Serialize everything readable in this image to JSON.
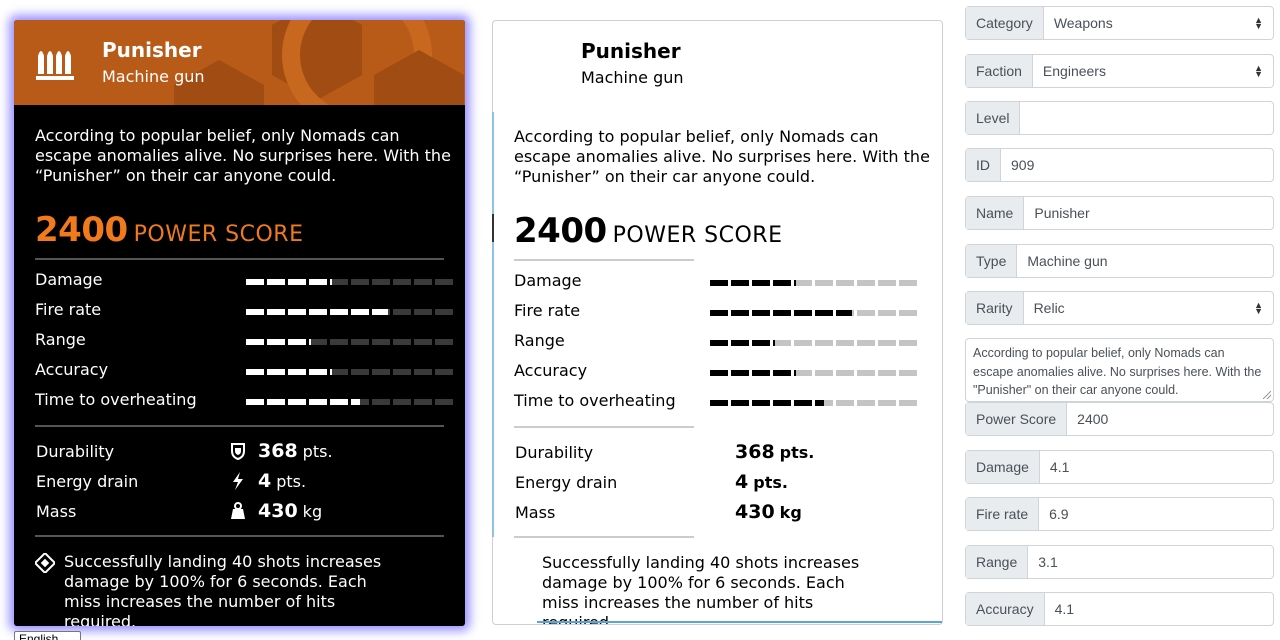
{
  "item": {
    "name": "Punisher",
    "type": "Machine gun",
    "description": "According to popular belief, only Nomads can escape anomalies alive. No surprises here. With the “Punisher” on their car anyone could.",
    "power_score": "2400",
    "power_score_label": "POWER SCORE",
    "stats": [
      {
        "label": "Damage",
        "value": 4.1
      },
      {
        "label": "Fire rate",
        "value": 6.9
      },
      {
        "label": "Range",
        "value": 3.1
      },
      {
        "label": "Accuracy",
        "value": 4.1
      },
      {
        "label": "Time to overheating",
        "value": 5.5
      }
    ],
    "info": [
      {
        "label": "Durability",
        "value": "368",
        "unit": "pts.",
        "icon": "shield-icon"
      },
      {
        "label": "Energy drain",
        "value": "4",
        "unit": "pts.",
        "icon": "lightning-icon"
      },
      {
        "label": "Mass",
        "value": "430",
        "unit": "kg",
        "icon": "weight-icon"
      }
    ],
    "perk": "Successfully landing 40 shots increases damage by 100% for 6 seconds. Each miss increases the number of hits required.",
    "perk_icon": "diamond-perk-icon",
    "header_icon": "ammo-bullets-icon",
    "bar_segments": 10
  },
  "colors": {
    "accent": "#f07a1c",
    "header_bg": "#b85a18",
    "glow": "#7f73ff",
    "bar_on_dark": "#ffffff",
    "bar_off_dark": "#3a3a3a",
    "bar_on_light": "#000000",
    "bar_off_light": "#c4c4c4"
  },
  "form": {
    "category": {
      "label": "Category",
      "value": "Weapons"
    },
    "faction": {
      "label": "Faction",
      "value": "Engineers"
    },
    "level": {
      "label": "Level",
      "value": ""
    },
    "id": {
      "label": "ID",
      "value": "909"
    },
    "name": {
      "label": "Name",
      "value": "Punisher"
    },
    "type": {
      "label": "Type",
      "value": "Machine gun"
    },
    "rarity": {
      "label": "Rarity",
      "value": "Relic"
    },
    "description": "According to popular belief, only Nomads can escape anomalies alive. No surprises here. With the \"Punisher\" on their car anyone could.",
    "power_score": {
      "label": "Power Score",
      "value": "2400"
    },
    "damage": {
      "label": "Damage",
      "value": "4.1"
    },
    "fire_rate": {
      "label": "Fire rate",
      "value": "6.9"
    },
    "range": {
      "label": "Range",
      "value": "3.1"
    },
    "accuracy": {
      "label": "Accuracy",
      "value": "4.1"
    }
  },
  "language": "English"
}
